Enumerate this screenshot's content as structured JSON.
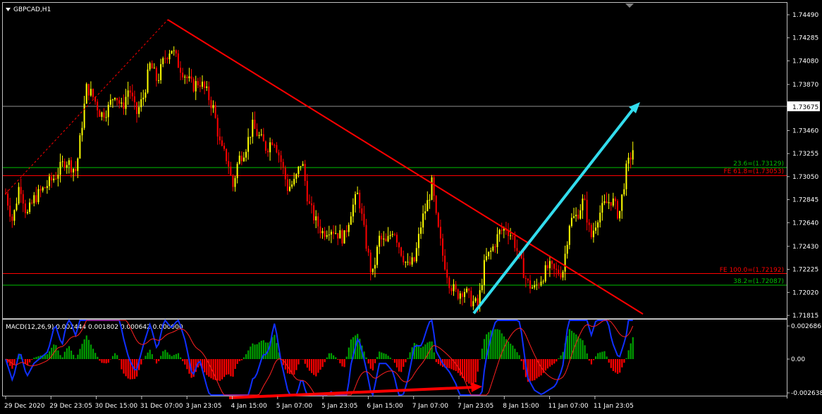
{
  "window": {
    "symbol_label": "GBPCAD,H1",
    "menu_icon": "triangle-down-icon",
    "scroll_marker_icon": "triangle-down-icon"
  },
  "colors": {
    "background": "#000000",
    "grid_frame": "#c0c0c0",
    "bull_candle": "#ffff00",
    "bear_candle": "#ff0000",
    "trendline": "#ff0000",
    "arrow": "#33ddee",
    "fib_green": "#00c000",
    "fib_red": "#ff0000",
    "macd_hist_pos": "#00a000",
    "macd_hist_neg": "#ff0000",
    "macd_main": "#1030ff",
    "macd_signal": "#ff2020",
    "divergence_arrow": "#ff0000"
  },
  "price_axis": {
    "ticks": [
      "1.74490",
      "1.74285",
      "1.74080",
      "1.73870",
      "1.73460",
      "1.73255",
      "1.73050",
      "1.72845",
      "1.72640",
      "1.72430",
      "1.72225",
      "1.72020",
      "1.71815"
    ],
    "current_price": "1.73675"
  },
  "levels": [
    {
      "label": "23.6=(1.73129)",
      "price": 1.73129,
      "color": "#00c000"
    },
    {
      "label": "FE 61.8=(1.73053)",
      "price": 1.73053,
      "color": "#ff0000"
    },
    {
      "label": "FE 100.0=(1.72192)",
      "price": 1.72192,
      "color": "#ff0000"
    },
    {
      "label": "38.2=(1.72087)",
      "price": 1.72087,
      "color": "#00c000"
    }
  ],
  "time_axis": {
    "labels": [
      "29 Dec 2020",
      "29 Dec 23:05",
      "30 Dec 15:00",
      "31 Dec 07:00",
      "3 Jan 23:05",
      "4 Jan 15:00",
      "5 Jan 07:00",
      "5 Jan 23:05",
      "6 Jan 15:00",
      "7 Jan 07:00",
      "7 Jan 23:05",
      "8 Jan 15:00",
      "11 Jan 07:00",
      "11 Jan 23:05"
    ]
  },
  "macd": {
    "title": "MACD(12,26,9) 0.002444 0.001802 0.000642 0.000000",
    "ticks": [
      "0.002686",
      "0.00",
      "-0.002638"
    ]
  },
  "chart_data": {
    "type": "candlestick",
    "symbol": "GBPCAD",
    "timeframe": "H1",
    "ylim": [
      1.718,
      1.7452
    ],
    "key_points": {
      "swing_high": 1.7449,
      "swing_low": 1.7185,
      "last_price": 1.73675
    },
    "path": [
      [
        0,
        1.729
      ],
      [
        10,
        1.7265
      ],
      [
        20,
        1.73
      ],
      [
        30,
        1.727
      ],
      [
        40,
        1.7285
      ],
      [
        55,
        1.7295
      ],
      [
        70,
        1.7305
      ],
      [
        85,
        1.732
      ],
      [
        100,
        1.731
      ],
      [
        108,
        1.735
      ],
      [
        115,
        1.7385
      ],
      [
        125,
        1.7375
      ],
      [
        135,
        1.736
      ],
      [
        145,
        1.7365
      ],
      [
        155,
        1.738
      ],
      [
        165,
        1.7365
      ],
      [
        175,
        1.7385
      ],
      [
        185,
        1.736
      ],
      [
        195,
        1.7375
      ],
      [
        205,
        1.7405
      ],
      [
        215,
        1.739
      ],
      [
        225,
        1.741
      ],
      [
        235,
        1.742
      ],
      [
        245,
        1.7405
      ],
      [
        255,
        1.7395
      ],
      [
        265,
        1.7385
      ],
      [
        275,
        1.739
      ],
      [
        285,
        1.738
      ],
      [
        295,
        1.7365
      ],
      [
        305,
        1.733
      ],
      [
        315,
        1.732
      ],
      [
        322,
        1.7295
      ],
      [
        330,
        1.732
      ],
      [
        340,
        1.733
      ],
      [
        350,
        1.735
      ],
      [
        360,
        1.734
      ],
      [
        370,
        1.733
      ],
      [
        380,
        1.734
      ],
      [
        390,
        1.732
      ],
      [
        400,
        1.7295
      ],
      [
        410,
        1.73
      ],
      [
        420,
        1.732
      ],
      [
        430,
        1.728
      ],
      [
        440,
        1.7265
      ],
      [
        450,
        1.7255
      ],
      [
        460,
        1.726
      ],
      [
        470,
        1.7255
      ],
      [
        480,
        1.725
      ],
      [
        490,
        1.7275
      ],
      [
        500,
        1.729
      ],
      [
        510,
        1.725
      ],
      [
        520,
        1.7215
      ],
      [
        530,
        1.725
      ],
      [
        540,
        1.7245
      ],
      [
        550,
        1.726
      ],
      [
        560,
        1.724
      ],
      [
        570,
        1.7225
      ],
      [
        580,
        1.723
      ],
      [
        590,
        1.7265
      ],
      [
        600,
        1.7285
      ],
      [
        605,
        1.73
      ],
      [
        610,
        1.727
      ],
      [
        620,
        1.7235
      ],
      [
        630,
        1.721
      ],
      [
        640,
        1.72
      ],
      [
        650,
        1.7205
      ],
      [
        660,
        1.7195
      ],
      [
        670,
        1.719
      ],
      [
        680,
        1.723
      ],
      [
        690,
        1.724
      ],
      [
        700,
        1.7255
      ],
      [
        710,
        1.726
      ],
      [
        720,
        1.725
      ],
      [
        730,
        1.723
      ],
      [
        740,
        1.721
      ],
      [
        750,
        1.7205
      ],
      [
        760,
        1.7215
      ],
      [
        770,
        1.7225
      ],
      [
        780,
        1.722
      ],
      [
        790,
        1.722
      ],
      [
        800,
        1.7265
      ],
      [
        810,
        1.727
      ],
      [
        820,
        1.7285
      ],
      [
        830,
        1.725
      ],
      [
        840,
        1.727
      ],
      [
        850,
        1.728
      ],
      [
        860,
        1.7285
      ],
      [
        870,
        1.727
      ],
      [
        880,
        1.731
      ],
      [
        890,
        1.733
      ],
      [
        898,
        1.73675
      ]
    ],
    "annotations": [
      "23.6=(1.73129)",
      "FE 61.8=(1.73053)",
      "FE 100.0=(1.72192)",
      "38.2=(1.72087)"
    ]
  }
}
